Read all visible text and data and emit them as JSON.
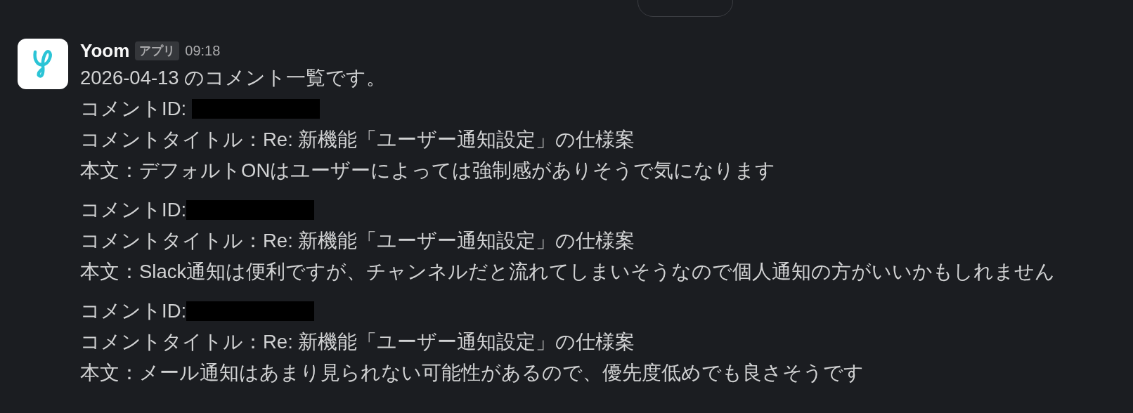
{
  "message": {
    "sender": "Yoom",
    "badge": "アプリ",
    "time": "09:18",
    "intro": "2026-04-13 のコメント一覧です。",
    "comments": [
      {
        "id_label": "コメントID: ",
        "title": "コメントタイトル：Re: 新機能「ユーザー通知設定」の仕様案",
        "body": "本文：デフォルトONはユーザーによっては強制感がありそうで気になります"
      },
      {
        "id_label": "コメントID:",
        "title": "コメントタイトル：Re: 新機能「ユーザー通知設定」の仕様案",
        "body": "本文：Slack通知は便利ですが、チャンネルだと流れてしまいそうなので個人通知の方がいいかもしれません"
      },
      {
        "id_label": "コメントID:",
        "title": "コメントタイトル：Re: 新機能「ユーザー通知設定」の仕様案",
        "body": "本文：メール通知はあまり見られない可能性があるので、優先度低めでも良さそうです"
      }
    ]
  }
}
